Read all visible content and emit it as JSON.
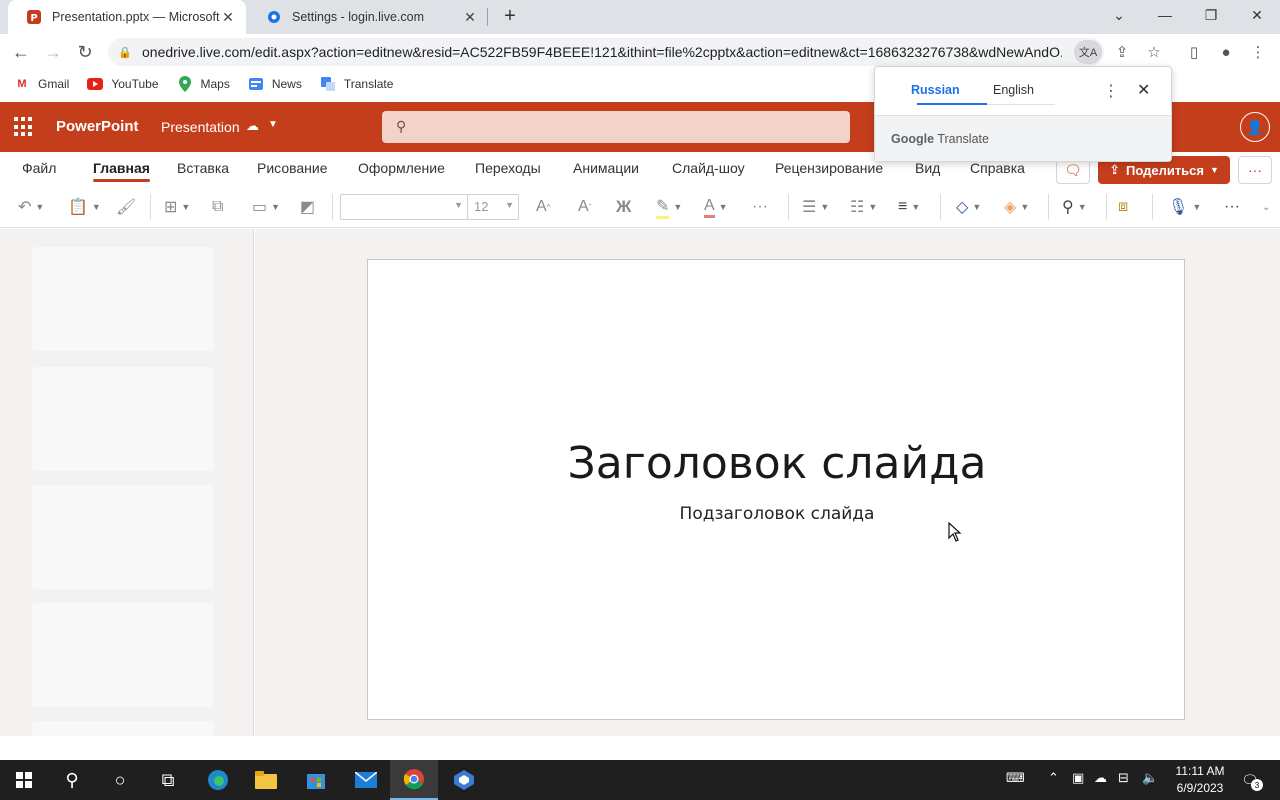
{
  "browser": {
    "tabs": [
      {
        "title": "Presentation.pptx — Microsoft PowerPoint",
        "active": true
      },
      {
        "title": "Settings - login.live.com",
        "active": false
      }
    ],
    "url": "onedrive.live.com/edit.aspx?action=editnew&resid=AC522FB59F4BEEE!121&ithint=file%2cpptx&action=editnew&ct=1686323276738&wdNewAndO...",
    "bookmarks": [
      {
        "label": "Gmail",
        "icon": "gmail-icon"
      },
      {
        "label": "YouTube",
        "icon": "youtube-icon"
      },
      {
        "label": "Maps",
        "icon": "maps-icon"
      },
      {
        "label": "News",
        "icon": "news-icon"
      },
      {
        "label": "Translate",
        "icon": "translate-icon"
      }
    ]
  },
  "app": {
    "name": "PowerPoint",
    "document": "Presentation",
    "accent": "#c43e1c"
  },
  "ribbon": {
    "tabs": [
      "Файл",
      "Главная",
      "Вставка",
      "Рисование",
      "Оформление",
      "Переходы",
      "Анимации",
      "Слайд-шоу",
      "Рецензирование",
      "Вид",
      "Справка"
    ],
    "active_tab": "Главная",
    "share_label": "Поделиться",
    "font_size": "12",
    "bold_glyph": "Ж"
  },
  "slide": {
    "title": "Заголовок слайда",
    "subtitle": "Подзаголовок слайда"
  },
  "translate_popup": {
    "source_lang": "Russian",
    "target_lang": "English",
    "brand_google": "Google",
    "brand_product": "Translate"
  },
  "taskbar": {
    "time": "11:11 AM",
    "date": "6/9/2023",
    "notifications": "3"
  }
}
